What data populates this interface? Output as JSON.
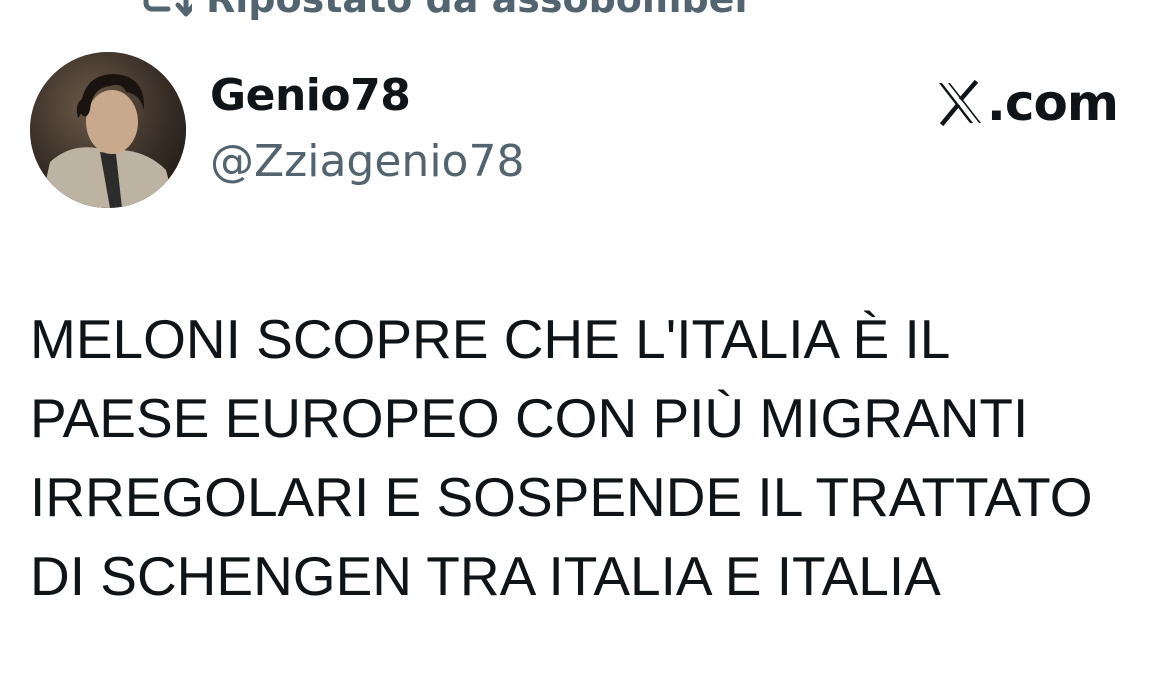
{
  "repost": {
    "label": "Ripostato da assobomber",
    "icon": "repost-icon"
  },
  "author": {
    "display_name": "Genio78",
    "handle": "@Zziagenio78",
    "avatar_icon": "avatar"
  },
  "brand": {
    "text": ".com",
    "icon": "x-logo-icon"
  },
  "tweet": {
    "lines": [
      "MELONI SCOPRE CHE L'ITALIA È IL",
      "PAESE EUROPEO CON PIÙ MIGRANTI",
      "IRREGOLARI E SOSPENDE IL TRATTATO",
      "DI SCHENGEN TRA ITALIA E ITALIA"
    ]
  },
  "colors": {
    "text": "#0f1419",
    "secondary": "#536471",
    "background": "#ffffff"
  }
}
